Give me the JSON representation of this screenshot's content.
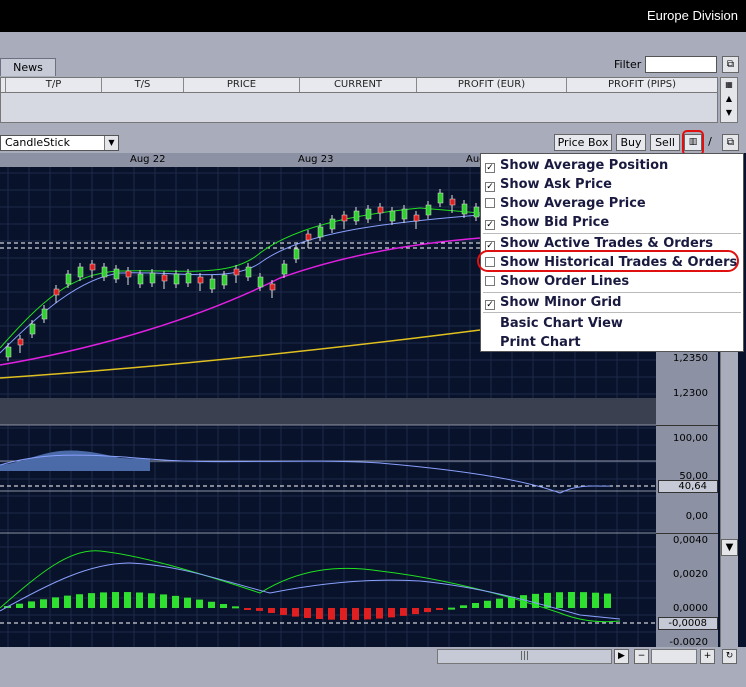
{
  "header": {
    "division": "Europe Division"
  },
  "panel": {
    "tab": "News",
    "filter_label": "Filter",
    "columns": [
      "T/P",
      "T/S",
      "PRICE",
      "CURRENT",
      "PROFIT (EUR)",
      "PROFIT (PIPS)"
    ]
  },
  "toolbar": {
    "chart_type": "CandleStick",
    "buttons": [
      "Price Box",
      "Buy",
      "Sell"
    ]
  },
  "chart": {
    "dates": [
      "Aug 22",
      "Aug 23",
      "Aug"
    ],
    "main_axis": [
      "1,2350",
      "1,2300"
    ],
    "rsi_axis": [
      "100,00",
      "50,00",
      "40,64",
      "0,00"
    ],
    "macd_axis": [
      "0,0040",
      "0,0020",
      "0,0000",
      "-0,0008",
      "-0,0020"
    ]
  },
  "menu": {
    "items": [
      {
        "label": "Show Average Position",
        "checked": true
      },
      {
        "label": "Show Ask Price",
        "checked": true
      },
      {
        "label": "Show Average Price",
        "checked": false
      },
      {
        "label": "Show Bid Price",
        "checked": true
      },
      {
        "label": "Show Active Trades & Orders",
        "checked": true
      },
      {
        "label": "Show Historical Trades & Orders",
        "checked": false
      },
      {
        "label": "Show Order Lines",
        "checked": false
      },
      {
        "label": "Show Minor Grid",
        "checked": true
      },
      {
        "label": "Basic Chart View",
        "checked": null
      },
      {
        "label": "Print Chart",
        "checked": null
      }
    ]
  },
  "colors": {
    "accent_red": "#e01010",
    "chart_bg": "#08122a"
  }
}
